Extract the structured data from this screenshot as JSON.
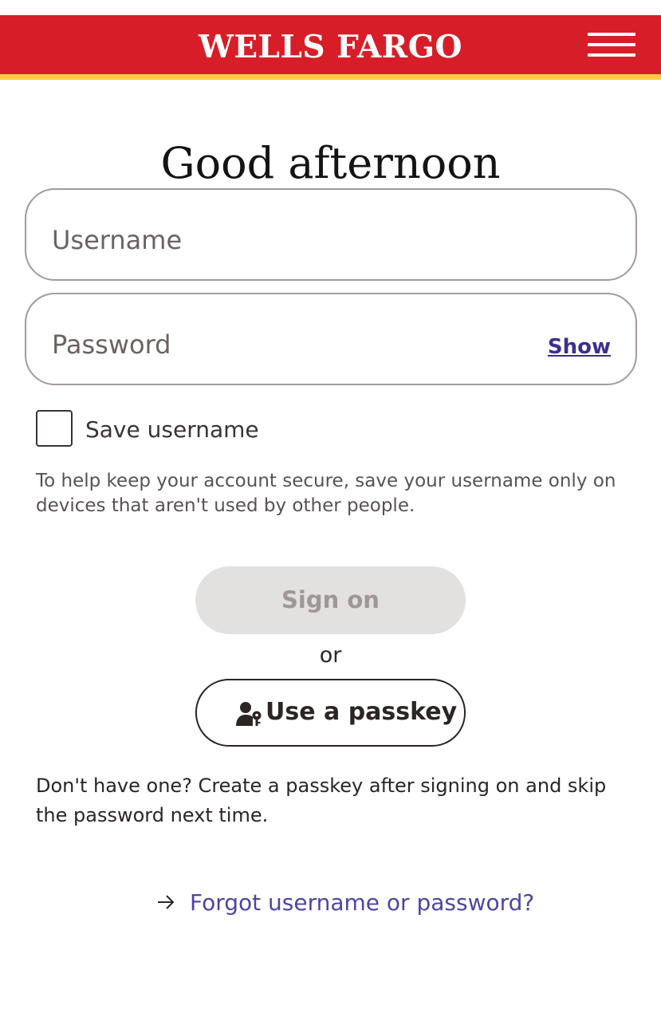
{
  "header": {
    "brand": "WELLS FARGO",
    "brand_color": "#d71e28",
    "accent_color": "#ffcd41",
    "menu_icon": "hamburger-menu-icon"
  },
  "main": {
    "greeting": "Good afternoon",
    "username": {
      "placeholder": "Username",
      "value": ""
    },
    "password": {
      "placeholder": "Password",
      "value": "",
      "show_label": "Show"
    },
    "save_username": {
      "label": "Save username",
      "checked": false
    },
    "help_text": "To help keep your account secure, save your username only on devices that aren't used by other people.",
    "sign_on_label": "Sign on",
    "or_label": "or",
    "passkey": {
      "label": "Use a passkey",
      "icon": "user-key-icon"
    },
    "passkey_note": "Don't have one? Create a passkey after signing on and skip the password next time.",
    "forgot": {
      "label": "Forgot username or password?",
      "icon": "arrow-right-icon",
      "link_color": "#4f44a3"
    }
  }
}
